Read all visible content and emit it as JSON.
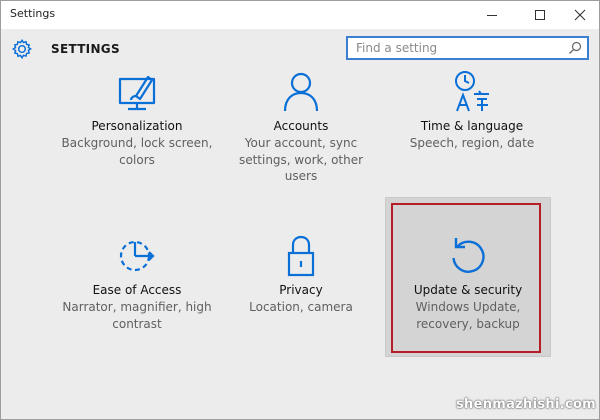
{
  "window": {
    "title": "Settings",
    "minimize_icon": "minimize-icon",
    "maximize_icon": "maximize-icon",
    "close_icon": "close-icon"
  },
  "header": {
    "title": "SETTINGS",
    "icon": "gear-icon"
  },
  "search": {
    "placeholder": "Find a setting",
    "icon": "search-icon"
  },
  "tiles": [
    {
      "name": "Personalization",
      "desc": "Background, lock screen, colors",
      "icon": "personalization-icon"
    },
    {
      "name": "Accounts",
      "desc": "Your account, sync settings, work, other users",
      "icon": "person-icon"
    },
    {
      "name": "Time & language",
      "desc": "Speech, region, date",
      "icon": "time-language-icon"
    },
    {
      "name": "Ease of Access",
      "desc": "Narrator, magnifier, high contrast",
      "icon": "ease-of-access-icon"
    },
    {
      "name": "Privacy",
      "desc": "Location, camera",
      "icon": "lock-icon"
    },
    {
      "name": "Update & security",
      "desc": "Windows Update, recovery, backup",
      "icon": "refresh-icon"
    }
  ],
  "watermark": "shenmazhishi.com",
  "colors": {
    "accent": "#0a6fd6",
    "highlight_border": "#b51e24"
  }
}
